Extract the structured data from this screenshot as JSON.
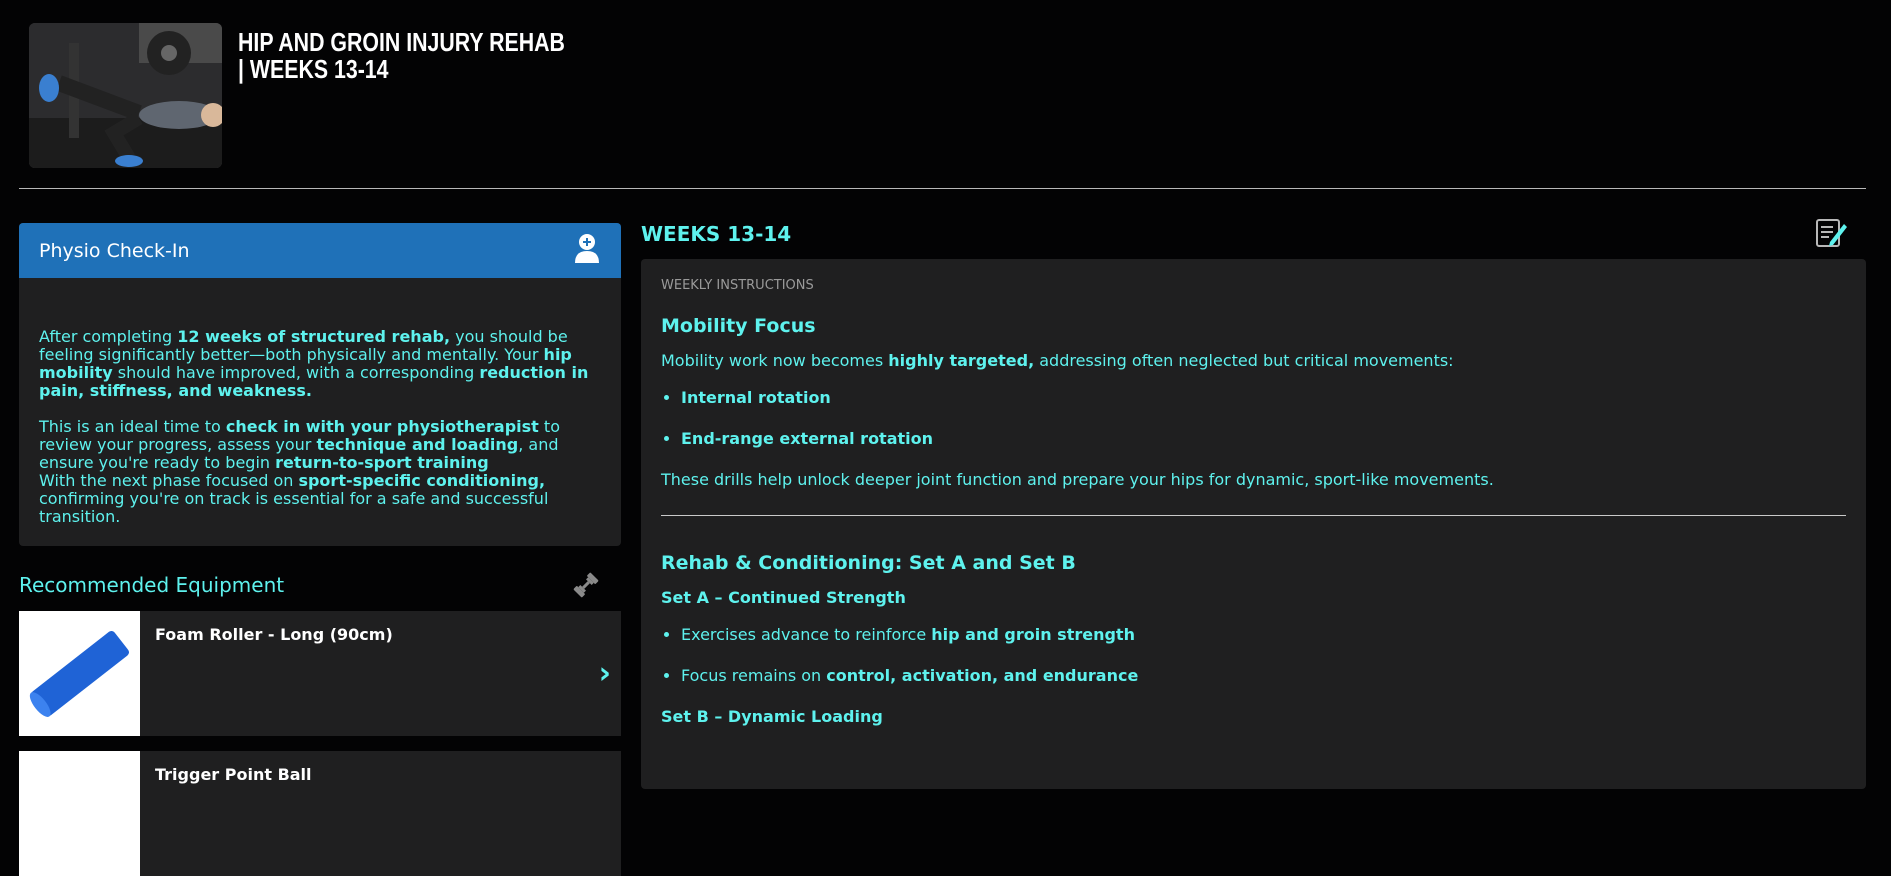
{
  "header": {
    "title": "HIP AND GROIN INJURY REHAB | WEEKS 13-14"
  },
  "physio": {
    "title": "Physio Check-In",
    "p1": [
      {
        "t": "After completing ",
        "b": false
      },
      {
        "t": "12 weeks of structured rehab,",
        "b": true
      },
      {
        "t": " you should be feeling significantly better—both physically and mentally. Your ",
        "b": false
      },
      {
        "t": "hip mobility",
        "b": true
      },
      {
        "t": " should have improved, with a corresponding ",
        "b": false
      },
      {
        "t": "reduction in pain, stiffness, and weakness.",
        "b": true
      }
    ],
    "p2": [
      {
        "t": "This is an ideal time to ",
        "b": false
      },
      {
        "t": "check in with your physiotherapist",
        "b": true
      },
      {
        "t": " to review your progress, assess your ",
        "b": false
      },
      {
        "t": "technique and loading",
        "b": true
      },
      {
        "t": ", and ensure you're ready to begin ",
        "b": false
      },
      {
        "t": "return-to-sport training",
        "b": true
      }
    ],
    "p3": [
      {
        "t": "With the next phase focused on ",
        "b": false
      },
      {
        "t": "sport-specific conditioning,",
        "b": true
      },
      {
        "t": " confirming you're on track is essential for a safe and successful transition.",
        "b": false
      }
    ]
  },
  "equipment": {
    "title": "Recommended Equipment",
    "items": [
      {
        "name": "Foam Roller - Long (90cm)"
      },
      {
        "name": "Trigger Point Ball"
      }
    ]
  },
  "weeks": {
    "label": "WEEKS 13-14",
    "section_label": "WEEKLY INSTRUCTIONS",
    "mobility_title": "Mobility Focus",
    "mobility_intro": [
      {
        "t": "Mobility work now becomes ",
        "b": false
      },
      {
        "t": "highly targeted,",
        "b": true
      },
      {
        "t": " addressing often neglected but critical movements:",
        "b": false
      }
    ],
    "mobility_items": [
      "Internal rotation",
      "End-range external rotation"
    ],
    "mobility_outro": "These drills help unlock deeper joint function and prepare your hips for dynamic, sport-like movements.",
    "rehab_title": "Rehab & Conditioning: Set A and Set B",
    "setA_title": "Set A – Continued Strength",
    "setA_items": [
      [
        {
          "t": "Exercises advance to reinforce ",
          "b": false
        },
        {
          "t": "hip and groin strength",
          "b": true
        }
      ],
      [
        {
          "t": "Focus remains on ",
          "b": false
        },
        {
          "t": "control, activation, and endurance",
          "b": true
        }
      ]
    ],
    "setB_title": "Set B – Dynamic Loading"
  },
  "colors": {
    "accent": "#5ef2ee",
    "header_blue": "#1f71b8",
    "panel": "#1f1f20",
    "background": "#030304"
  },
  "icons": [
    "person-pin-icon",
    "dumbbell-icon",
    "chevron-right-icon",
    "notes-icon"
  ]
}
